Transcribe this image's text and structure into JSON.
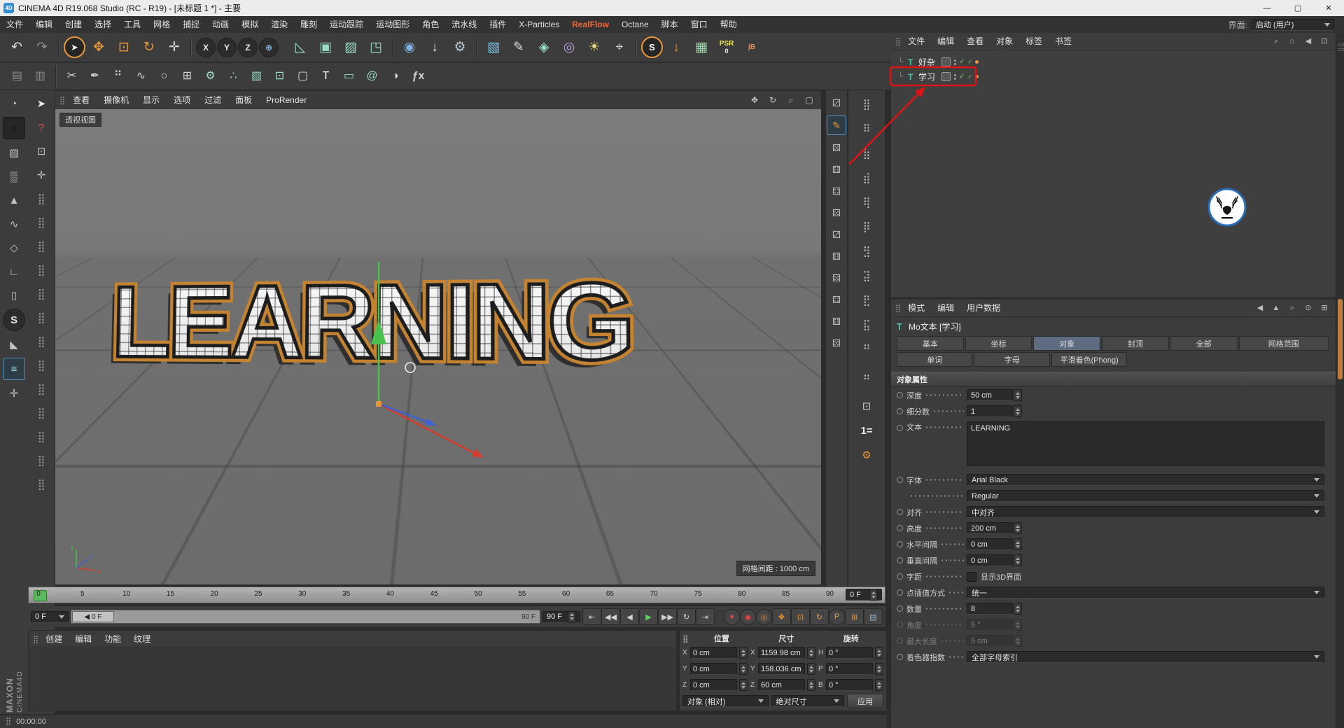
{
  "window": {
    "title": "CINEMA 4D R19.068 Studio (RC - R19) - [未标题 1 *] - 主要",
    "controls": {
      "minimize": "—",
      "maximize": "▢",
      "close": "✕"
    }
  },
  "menubar": {
    "items": [
      "文件",
      "编辑",
      "创建",
      "选择",
      "工具",
      "网格",
      "捕捉",
      "动画",
      "模拟",
      "渲染",
      "雕刻",
      "运动跟踪",
      "运动图形",
      "角色",
      "流水线",
      "插件",
      "X-Particles",
      "RealFlow",
      "Octane",
      "脚本",
      "窗口",
      "帮助"
    ],
    "highlight_item": "RealFlow",
    "highlight_color": "#f06a3a",
    "interface_label": "界面:",
    "interface_value": "启动 (用户)"
  },
  "toolbar1": [
    {
      "name": "undo-icon",
      "glyph": "↶",
      "color": "#d8d8d8"
    },
    {
      "name": "redo-icon",
      "glyph": "↷",
      "color": "#8a8a8a"
    },
    {
      "sep": true
    },
    {
      "name": "live-selection-icon",
      "glyph": "➤",
      "color": "#f2f2f2",
      "kind": "ring"
    },
    {
      "name": "move-tool-icon",
      "glyph": "✥",
      "color": "#e8963c"
    },
    {
      "name": "scale-tool-icon",
      "glyph": "⊡",
      "color": "#e8963c"
    },
    {
      "name": "rotate-tool-icon",
      "glyph": "↻",
      "color": "#e8963c"
    },
    {
      "name": "last-used-tool-icon",
      "glyph": "✛",
      "color": "#d2d2d2"
    },
    {
      "sep": true
    },
    {
      "name": "x-axis-lock-icon",
      "glyph": "X",
      "color": "#ececec",
      "kind": "circle"
    },
    {
      "name": "y-axis-lock-icon",
      "glyph": "Y",
      "color": "#ececec",
      "kind": "circle"
    },
    {
      "name": "z-axis-lock-icon",
      "glyph": "Z",
      "color": "#ececec",
      "kind": "circle"
    },
    {
      "name": "coord-system-icon",
      "glyph": "⊕",
      "color": "#8fc0e8",
      "kind": "circle"
    },
    {
      "sep": true
    },
    {
      "name": "make-editable-icon",
      "glyph": "◺",
      "color": "#9adcc8"
    },
    {
      "name": "model-mode-icon",
      "glyph": "▣",
      "color": "#9adcc8"
    },
    {
      "name": "texture-mode-icon",
      "glyph": "▨",
      "color": "#9adcc8"
    },
    {
      "name": "workplane-icon",
      "glyph": "◳",
      "color": "#9adcc8"
    },
    {
      "sep": true
    },
    {
      "name": "render-view-icon",
      "glyph": "◉",
      "color": "#7fb2e0"
    },
    {
      "name": "render-picture-viewer-icon",
      "glyph": "↓",
      "color": "#e0e0e0"
    },
    {
      "name": "render-settings-icon",
      "glyph": "⚙",
      "color": "#b8c8d4"
    },
    {
      "sep": true
    },
    {
      "name": "primitive-cube-icon",
      "glyph": "▧",
      "color": "#86c8e8"
    },
    {
      "name": "spline-pen-icon",
      "glyph": "✎",
      "color": "#d8d8d8"
    },
    {
      "name": "generators-icon",
      "glyph": "◈",
      "color": "#9adcc8"
    },
    {
      "name": "deformers-icon",
      "glyph": "◎",
      "color": "#b8a0e0"
    },
    {
      "name": "light-icon",
      "glyph": "☀",
      "color": "#e8d87a"
    },
    {
      "name": "camera-icon",
      "glyph": "⌖",
      "color": "#c8c8c8"
    },
    {
      "sep": true
    },
    {
      "name": "sketch-toon-icon",
      "glyph": "S",
      "color": "#ffffff",
      "kind": "ring"
    },
    {
      "name": "drop-to-floor-icon",
      "glyph": "↓",
      "color": "#e8963c"
    },
    {
      "name": "ic-tools-icon",
      "glyph": "▦",
      "color": "#9fd8b0"
    },
    {
      "name": "psr-transfer-icon",
      "glyph": "PSR",
      "sub": "0",
      "color": "#f0e84a",
      "kind": "text2"
    },
    {
      "name": "jb-plugin-icon",
      "glyph": "jB",
      "sub": "",
      "color": "#e88a5a",
      "kind": "text2"
    }
  ],
  "toolbar2": [
    {
      "name": "workplane-lock-icon",
      "glyph": "▤",
      "color": "#8a8a8a"
    },
    {
      "name": "workplane-snap-icon",
      "glyph": "▥",
      "color": "#8a8a8a"
    },
    {
      "sep": true
    },
    {
      "name": "knife-icon",
      "glyph": "✂",
      "color": "#d4d4d4"
    },
    {
      "name": "pen-icon",
      "glyph": "✒",
      "color": "#d4d4d4"
    },
    {
      "name": "points-icon",
      "glyph": "⠛",
      "color": "#d4d4d4"
    },
    {
      "name": "spline-smooth-icon",
      "glyph": "∿",
      "color": "#d4d4d4"
    },
    {
      "name": "circle-spline-icon",
      "glyph": "○",
      "color": "#d4d4d4"
    },
    {
      "name": "grid-array-icon",
      "glyph": "⊞",
      "color": "#d4d4d4"
    },
    {
      "name": "gear-object-icon",
      "glyph": "⚙",
      "color": "#9adcc8"
    },
    {
      "name": "particles-icon",
      "glyph": "∴",
      "color": "#9adcc8"
    },
    {
      "name": "cube-object-icon",
      "glyph": "▧",
      "color": "#9adcc8"
    },
    {
      "name": "cubes-array-icon",
      "glyph": "⊡",
      "color": "#9adcc8"
    },
    {
      "name": "wire-cube-icon",
      "glyph": "▢",
      "color": "#d4d4d4"
    },
    {
      "name": "motext-icon",
      "glyph": "T",
      "color": "#ffffff"
    },
    {
      "name": "capsule-icon",
      "glyph": "▭",
      "color": "#9adcc8"
    },
    {
      "name": "spiral-icon",
      "glyph": "@",
      "color": "#9adcc8"
    },
    {
      "name": "shading-icon",
      "glyph": "◑",
      "color": "#d4d4d4"
    },
    {
      "name": "xpresso-icon",
      "glyph": "ƒx",
      "sub": "",
      "color": "#cfcfcf",
      "kind": "text2"
    }
  ],
  "leftcol1": [
    {
      "name": "view-nav-icon",
      "glyph": "◔",
      "color": "#c2c2c2"
    },
    {
      "name": "model-cube-icon",
      "glyph": "■",
      "color": "#1f1f1f",
      "kind": "dark"
    },
    {
      "name": "texture-paint-icon",
      "glyph": "▨",
      "color": "#c2c2c2"
    },
    {
      "name": "halftone-icon",
      "glyph": "▒",
      "color": "#c2c2c2"
    },
    {
      "name": "cone-tool-icon",
      "glyph": "▲",
      "color": "#c2c2c2"
    },
    {
      "name": "spline-tool-icon",
      "glyph": "∿",
      "color": "#c2c2c2"
    },
    {
      "name": "polygon-tool-icon",
      "glyph": "◇",
      "color": "#c2c2c2"
    },
    {
      "name": "measure-icon",
      "glyph": "∟",
      "color": "#c2c2c2"
    },
    {
      "name": "mouse-mode-icon",
      "glyph": "▯",
      "color": "#c2c2c2"
    },
    {
      "name": "sculpt-mode-icon",
      "glyph": "S",
      "color": "#e2e2e2",
      "kind": "circle"
    },
    {
      "name": "paint-bucket-icon",
      "glyph": "◣",
      "color": "#c2c2c2"
    },
    {
      "name": "layer-mode-icon",
      "glyph": "≡",
      "color": "#8fd0e8",
      "kind": "active"
    },
    {
      "name": "axis-mode-icon",
      "glyph": "✛",
      "color": "#c2c2c2"
    }
  ],
  "leftcol2": [
    {
      "name": "pointer-icon",
      "glyph": "➤",
      "color": "#ececec"
    },
    {
      "name": "question-icon",
      "glyph": "?",
      "color": "#e05050"
    },
    {
      "name": "box-select-icon",
      "glyph": "⊡",
      "color": "#c2c2c2"
    },
    {
      "name": "snap-move-icon",
      "glyph": "✛",
      "color": "#c2c2c2"
    },
    {
      "name": "palette-slot-icon",
      "glyph": "⣿",
      "color": "#9a9a9a",
      "repeat": 13
    }
  ],
  "stripA": [
    {
      "name": "snap-palette-icon",
      "glyph": "⚂",
      "color": "#b6b6b6"
    },
    {
      "name": "spline-pen-highlight-icon",
      "glyph": "✎",
      "color": "#e8963c",
      "kind": "active"
    },
    {
      "name": "command-palette-icon",
      "glyph": "⚄",
      "color": "#b6b6b6"
    },
    {
      "name": "command-palette-icon",
      "glyph": "⚅",
      "color": "#b6b6b6"
    },
    {
      "name": "command-palette-icon",
      "glyph": "⚃",
      "color": "#b6b6b6"
    },
    {
      "name": "command-palette-icon",
      "glyph": "⚄",
      "color": "#b6b6b6"
    },
    {
      "name": "command-palette-icon",
      "glyph": "⚂",
      "color": "#b6b6b6"
    },
    {
      "name": "command-palette-icon",
      "glyph": "⚅",
      "color": "#b6b6b6"
    },
    {
      "name": "command-palette-icon",
      "glyph": "⚄",
      "color": "#b6b6b6"
    },
    {
      "name": "command-palette-icon",
      "glyph": "⚃",
      "color": "#b6b6b6"
    },
    {
      "name": "command-palette-icon",
      "glyph": "⚅",
      "color": "#b6b6b6"
    },
    {
      "name": "command-palette-icon",
      "glyph": "⚄",
      "color": "#b6b6b6"
    }
  ],
  "stripB": [
    {
      "name": "array-palette-icon",
      "glyph": "⣿",
      "color": "#b6b6b6"
    },
    {
      "name": "array-palette-icon",
      "glyph": "⠿",
      "color": "#b6b6b6"
    },
    {
      "name": "array-palette-icon",
      "glyph": "⣷",
      "color": "#b6b6b6"
    },
    {
      "name": "array-palette-icon",
      "glyph": "⣾",
      "color": "#b6b6b6"
    },
    {
      "name": "array-palette-icon",
      "glyph": "⢿",
      "color": "#b6b6b6"
    },
    {
      "name": "array-palette-icon",
      "glyph": "⡿",
      "color": "#b6b6b6"
    },
    {
      "name": "array-palette-icon",
      "glyph": "⣻",
      "color": "#b6b6b6"
    },
    {
      "name": "array-palette-icon",
      "glyph": "⣽",
      "color": "#b6b6b6"
    },
    {
      "name": "array-palette-icon",
      "glyph": "⣟",
      "color": "#b6b6b6"
    },
    {
      "name": "array-palette-icon",
      "glyph": "⣯",
      "color": "#b6b6b6"
    },
    {
      "name": "array-palette-icon",
      "glyph": "⠛",
      "color": "#b6b6b6"
    },
    {
      "name": "array-palette-icon",
      "glyph": "⣤",
      "color": "#b6b6b6"
    },
    {
      "name": "snap-cube-icon",
      "glyph": "⊡",
      "color": "#c8c8c8",
      "gap": true
    },
    {
      "name": "layer-solo-icon",
      "glyph": "1=",
      "sub": "",
      "color": "#ececec",
      "kind": "text2"
    },
    {
      "name": "project-settings-gear-icon",
      "glyph": "⚙",
      "color": "#e8963c"
    }
  ],
  "viewport": {
    "menus": [
      "查看",
      "摄像机",
      "显示",
      "选项",
      "过滤",
      "面板",
      "ProRender"
    ],
    "right_icons": [
      {
        "name": "pan-icon",
        "glyph": "✥"
      },
      {
        "name": "orbit-icon",
        "glyph": "↻"
      },
      {
        "name": "zoom-icon",
        "glyph": "⌕"
      },
      {
        "name": "maximize-icon",
        "glyph": "▢"
      }
    ],
    "view_label": "透视视图",
    "text3d": "LEARNING",
    "grid_label": "网格间距 : 1000 cm",
    "axis_labels": {
      "x": "x",
      "y": "y",
      "z": "z"
    }
  },
  "object_manager": {
    "menus": [
      "文件",
      "编辑",
      "查看",
      "对象",
      "标签",
      "书签"
    ],
    "right_icons": [
      {
        "name": "search-icon",
        "glyph": "⌕"
      },
      {
        "name": "home-icon",
        "glyph": "⌂"
      },
      {
        "name": "back-icon",
        "glyph": "◀"
      },
      {
        "name": "dock-icon",
        "glyph": "⊡"
      }
    ],
    "objects": [
      {
        "name": "好杂"
      },
      {
        "name": "学习",
        "annotated": true
      }
    ]
  },
  "attribute_manager": {
    "menus": [
      "模式",
      "编辑",
      "用户数据"
    ],
    "right_icons": [
      {
        "name": "nav-back-icon",
        "glyph": "◀"
      },
      {
        "name": "nav-up-icon",
        "glyph": "▲"
      },
      {
        "name": "search-icon",
        "glyph": "⌕"
      },
      {
        "name": "lock-icon",
        "glyph": "⊙"
      },
      {
        "name": "panel-menu-icon",
        "glyph": "⊞"
      }
    ],
    "object_title": "Mo文本 [学习]",
    "tabs": [
      {
        "label": "基本"
      },
      {
        "label": "坐标"
      },
      {
        "label": "对象",
        "active": true
      },
      {
        "label": "封顶"
      },
      {
        "label": "全部"
      },
      {
        "label": "网格范围",
        "wide": true
      }
    ],
    "subtabs": [
      "单词",
      "字母",
      "平滑着色(Phong)"
    ],
    "section_title": "对象属性",
    "params": [
      {
        "label": "深度",
        "type": "stepper",
        "value": "50 cm"
      },
      {
        "label": "细分数",
        "type": "stepper",
        "value": "1"
      },
      {
        "label": "文本",
        "type": "textarea",
        "value": "LEARNING"
      },
      {
        "label": "字体",
        "type": "dropdown",
        "value": "Arial Black"
      },
      {
        "label": "",
        "type": "dropdown",
        "value": "Regular",
        "nodot": true
      },
      {
        "label": "对齐",
        "type": "dropdown",
        "value": "中对齐"
      },
      {
        "label": "高度",
        "type": "stepper",
        "value": "200 cm"
      },
      {
        "label": "水平间隔",
        "type": "stepper",
        "value": "0 cm"
      },
      {
        "label": "垂直间隔",
        "type": "stepper",
        "value": "0 cm"
      },
      {
        "label": "字距",
        "type": "checkbox",
        "value": "显示3D界面",
        "checked": false
      },
      {
        "label": "点插值方式",
        "type": "dropdown",
        "value": "统一"
      },
      {
        "label": "数量",
        "type": "stepper",
        "value": "8"
      },
      {
        "label": "角度",
        "type": "stepper",
        "value": "5 °",
        "disabled": true
      },
      {
        "label": "最大长度",
        "type": "stepper",
        "value": "5 cm",
        "disabled": true
      },
      {
        "label": "着色器指数",
        "type": "dropdown",
        "value": "全部字母索引"
      }
    ]
  },
  "timeline": {
    "ticks": [
      0,
      5,
      10,
      15,
      20,
      25,
      30,
      35,
      40,
      45,
      50,
      55,
      60,
      65,
      70,
      75,
      80,
      85,
      90
    ],
    "frame_box": "0 F",
    "current_field": "0 F",
    "slider_handle": "0 F",
    "slider_end": "90 F",
    "end_field": "90 F",
    "transport": [
      {
        "name": "goto-start-button",
        "glyph": "⇤"
      },
      {
        "name": "prev-key-button",
        "glyph": "◀◀"
      },
      {
        "name": "prev-frame-button",
        "glyph": "◀"
      },
      {
        "name": "play-button",
        "glyph": "▶",
        "color": "#5fd05f"
      },
      {
        "name": "next-frame-button",
        "glyph": "▶▶"
      },
      {
        "name": "loop-button",
        "glyph": "↻"
      },
      {
        "name": "goto-end-button",
        "glyph": "⇥"
      }
    ],
    "record_buttons": [
      {
        "name": "record-key-button",
        "glyph": "●",
        "color": "#e04848",
        "kind": "circle"
      },
      {
        "name": "autokey-button",
        "glyph": "◉",
        "color": "#e04848",
        "kind": "circle"
      },
      {
        "name": "keyframe-selection-button",
        "glyph": "◎",
        "color": "#e08a3c",
        "kind": "circle"
      },
      {
        "name": "record-position-toggle",
        "glyph": "✥",
        "color": "#e8963c"
      },
      {
        "name": "record-scale-toggle",
        "glyph": "⊡",
        "color": "#e8963c"
      },
      {
        "name": "record-rotation-toggle",
        "glyph": "↻",
        "color": "#e8963c"
      },
      {
        "name": "record-parameter-toggle",
        "glyph": "P",
        "color": "#e8963c",
        "kind": "circle"
      },
      {
        "name": "record-pla-toggle",
        "glyph": "⊞",
        "color": "#e8963c"
      },
      {
        "name": "timeline-window-button",
        "glyph": "▤",
        "color": "#8fb8d8"
      }
    ]
  },
  "material_manager": {
    "menus": [
      "创建",
      "编辑",
      "功能",
      "纹理"
    ]
  },
  "coordinates": {
    "col_headers": [
      "位置",
      "尺寸",
      "旋转"
    ],
    "rows": [
      {
        "cells": [
          {
            "l": "X",
            "v": "0 cm"
          },
          {
            "l": "X",
            "v": "1159.98 cm"
          },
          {
            "l": "H",
            "v": "0 °"
          }
        ]
      },
      {
        "cells": [
          {
            "l": "Y",
            "v": "0 cm"
          },
          {
            "l": "Y",
            "v": "158.036 cm"
          },
          {
            "l": "P",
            "v": "0 °"
          }
        ]
      },
      {
        "cells": [
          {
            "l": "Z",
            "v": "0 cm"
          },
          {
            "l": "Z",
            "v": "60 cm"
          },
          {
            "l": "B",
            "v": "0 °"
          }
        ]
      }
    ],
    "dropdowns": [
      "对象 (相对)",
      "绝对尺寸"
    ],
    "apply_button": "应用"
  },
  "statusbar": {
    "time": "00:00:00"
  },
  "brand": {
    "line1": "MAXON",
    "line2": "CINEMA4D"
  },
  "annotation": {
    "color": "#e01212"
  },
  "watermark": {
    "border_color": "#2a6db5"
  }
}
